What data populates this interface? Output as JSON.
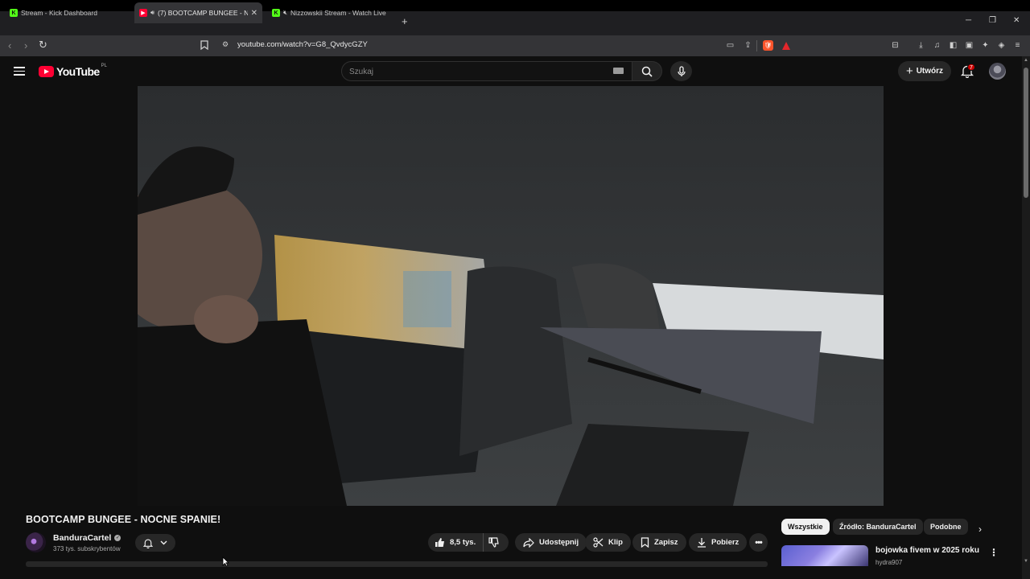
{
  "browser": {
    "tabs": [
      {
        "favicon": "kick",
        "label": "Stream - Kick Dashboard",
        "active": false
      },
      {
        "favicon": "youtube",
        "label": "(7) BOOTCAMP BUNGEE - NO",
        "active": true
      },
      {
        "favicon": "kick",
        "label": "Nizzowskii Stream - Watch Live o",
        "active": false
      }
    ],
    "new_tab": "+",
    "url": "youtube.com/watch?v=G8_QvdycGZY",
    "brave_shield_count": "",
    "brave_rewards_count": "1"
  },
  "youtube": {
    "logo_text": "YouTube",
    "country_code": "PL",
    "search_placeholder": "Szukaj",
    "create_label": "Utwórz",
    "notification_count": "7"
  },
  "video": {
    "title": "BOOTCAMP BUNGEE - NOCNE SPANIE!",
    "channel_name": "BanduraCartel",
    "subscribers": "373 tys. subskrybentów",
    "likes": "8,5 tys.",
    "actions": {
      "share": "Udostępnij",
      "clip": "Klip",
      "save": "Zapisz",
      "download": "Pobierz"
    }
  },
  "sidebar": {
    "chips": [
      "Wszystkie",
      "Źródło: BanduraCartel",
      "Podobne"
    ],
    "recommendation": {
      "title": "bojowka fivem w 2025 roku",
      "channel": "hydra907"
    }
  },
  "colors": {
    "background": "#0f0f0f",
    "youtube_red": "#ff0033",
    "kick_green": "#53fc18",
    "badge_red": "#cc0000"
  }
}
